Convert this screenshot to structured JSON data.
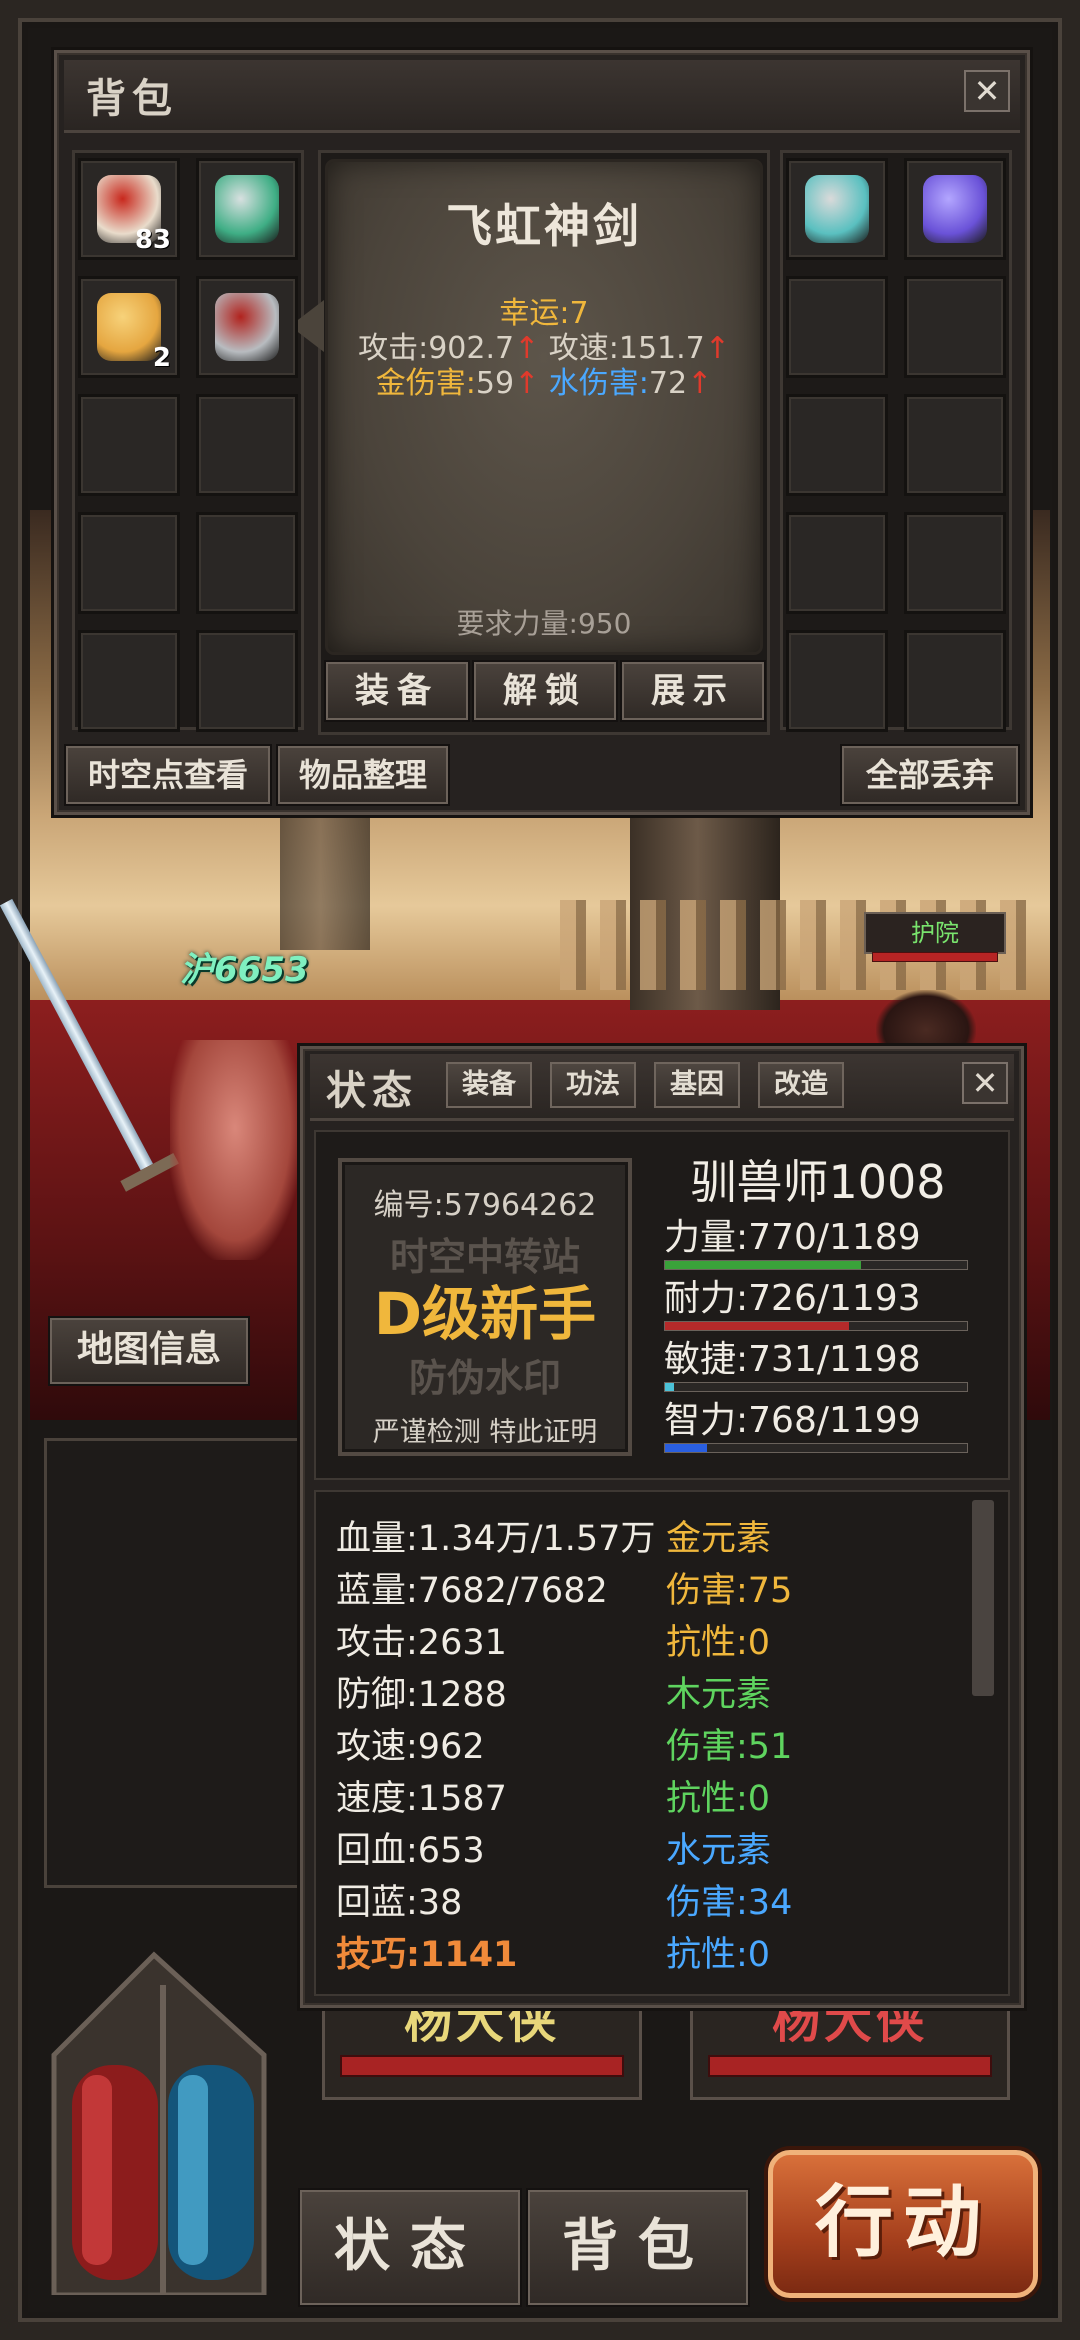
{
  "bag": {
    "title": "背包",
    "close": "✕",
    "left_items": [
      {
        "name": "item-bag",
        "qty": "83",
        "color": "#e9dccb",
        "accent": "#c8281d"
      },
      {
        "name": "item-helm-green",
        "qty": "",
        "color": "#3fae85",
        "accent": "#d8e0e0"
      },
      {
        "name": "item-gem-amber",
        "qty": "2",
        "color": "#e5a640",
        "accent": "#f7d27a"
      },
      {
        "name": "item-sword",
        "qty": "",
        "color": "#b8bcc0",
        "accent": "#b1231e"
      }
    ],
    "right_items": [
      {
        "name": "item-armor-teal",
        "qty": "",
        "color": "#5ac0c0",
        "accent": "#dadada"
      },
      {
        "name": "item-crystal-purple",
        "qty": "",
        "color": "#6a52d8",
        "accent": "#b3a6ff"
      }
    ],
    "buttons": {
      "spacetime": "时空点查看",
      "sort": "物品整理",
      "discard": "全部丢弃"
    }
  },
  "tooltip": {
    "name": "飞虹神剑",
    "luck": "幸运:7",
    "attack_label": "攻击:",
    "attack_value": "902.7",
    "speed_label": "攻速:",
    "speed_value": "151.7",
    "gold_dmg_label": "金伤害:",
    "gold_dmg_value": "59",
    "water_dmg_label": "水伤害:",
    "water_dmg_value": "72",
    "arrow": "↑",
    "requirement": "要求力量:950",
    "actions": {
      "equip": "装备",
      "unlock": "解锁",
      "show": "展示"
    }
  },
  "scene": {
    "damage_text": "沪6653",
    "npc_label": "护院",
    "map_info": "地图信息",
    "banner_left": "杨大侠",
    "banner_right": "杨大侠"
  },
  "status": {
    "title": "状态",
    "tabs": {
      "equip": "装备",
      "skill": "功法",
      "gene": "基因",
      "modify": "改造"
    },
    "close": "✕",
    "watermark": {
      "serial_label": "编号:",
      "serial": "57964262",
      "line1": "时空中转站",
      "rank": "D级新手",
      "line3": "防伪水印",
      "footer": "严谨检测 特此证明"
    },
    "player_name": "驯兽师1008",
    "attributes": [
      {
        "label": "力量:",
        "value": "770/1189",
        "pct": 0.65,
        "color": "#3aa23a"
      },
      {
        "label": "耐力:",
        "value": "726/1193",
        "pct": 0.61,
        "color": "#b52a2a"
      },
      {
        "label": "敏捷:",
        "value": "731/1198",
        "pct": 0.03,
        "color": "#4cc2d8"
      },
      {
        "label": "智力:",
        "value": "768/1199",
        "pct": 0.14,
        "color": "#2a5fe0"
      }
    ],
    "left_stats": [
      {
        "label": "血量:",
        "value": "1.34万/1.57万"
      },
      {
        "label": "蓝量:",
        "value": "7682/7682"
      },
      {
        "label": "攻击:",
        "value": "2631"
      },
      {
        "label": "防御:",
        "value": "1288"
      },
      {
        "label": "攻速:",
        "value": "962"
      },
      {
        "label": "速度:",
        "value": "1587"
      },
      {
        "label": "回血:",
        "value": "653"
      },
      {
        "label": "回蓝:",
        "value": "38"
      },
      {
        "label": "技巧:",
        "value": "1141"
      }
    ],
    "right_stats": [
      {
        "label": "金元素",
        "value": "",
        "color": "#f0b73c"
      },
      {
        "label": "伤害:",
        "value": "75",
        "color": "#f0b73c"
      },
      {
        "label": "抗性:",
        "value": "0",
        "color": "#f0b73c"
      },
      {
        "label": "木元素",
        "value": "",
        "color": "#5fd45f"
      },
      {
        "label": "伤害:",
        "value": "51",
        "color": "#5fd45f"
      },
      {
        "label": "抗性:",
        "value": "0",
        "color": "#5fd45f"
      },
      {
        "label": "水元素",
        "value": "",
        "color": "#4aa8ff"
      },
      {
        "label": "伤害:",
        "value": "34",
        "color": "#4aa8ff"
      },
      {
        "label": "抗性:",
        "value": "0",
        "color": "#4aa8ff"
      }
    ]
  },
  "bottom": {
    "status": "状态",
    "bag": "背包",
    "action": "行动"
  }
}
